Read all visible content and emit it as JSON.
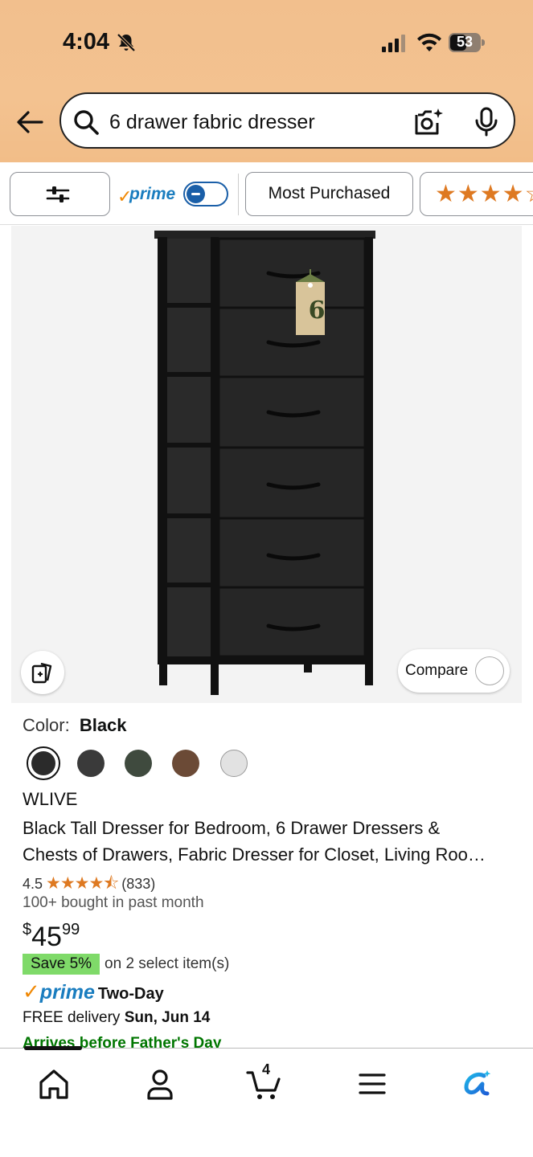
{
  "status_bar": {
    "time": "4:04",
    "battery": "53",
    "icons": [
      "bell-slash-icon",
      "cellular-signal-icon",
      "wifi-icon",
      "battery-icon"
    ]
  },
  "search": {
    "query": "6 drawer fabric dresser",
    "icons": [
      "back-arrow-icon",
      "search-icon",
      "camera-icon",
      "microphone-icon"
    ]
  },
  "filters": {
    "prime_label": "prime",
    "prime_toggle_on": false,
    "most_purchased": "Most Purchased",
    "stars_chip": "★★★★☆"
  },
  "product_image": {
    "tag_number": "6",
    "compare_label": "Compare"
  },
  "product": {
    "color_label": "Color:",
    "color_value": "Black",
    "swatches": [
      "#2b2b2b",
      "#3a3a3a",
      "#3f4a3e",
      "#6b4a36",
      "#e2e2e2"
    ],
    "brand": "WLIVE",
    "title_line1": "Black Tall Dresser for Bedroom, 6 Drawer Dressers &",
    "title_line2": "Chests of Drawers, Fabric Dresser for Closet, Living Roo…",
    "rating": "4.5",
    "stars": "★★★★⯪",
    "review_count": "(833)",
    "bought": "100+ bought in past month",
    "price_currency": "$",
    "price_whole": "45",
    "price_fraction": "99",
    "save_badge": "Save 5%",
    "save_text": "on 2 select item(s)",
    "prime_check": "✓",
    "prime_word": "prime",
    "prime_speed": "Two-Day",
    "delivery_prefix": "FREE delivery",
    "delivery_date": "Sun, Jun 14",
    "arrives": "Arrives before Father's Day"
  },
  "bottom_nav": {
    "cart_count": "4",
    "items": [
      "home-icon",
      "account-icon",
      "cart-icon",
      "menu-icon",
      "rufus-icon"
    ]
  },
  "colors": {
    "header_bg": "#f2bf8d",
    "link_blue": "#1a7dbf",
    "prime_orange": "#f08804",
    "star_orange": "#de7921",
    "save_green": "#7fda69",
    "arrives_green": "#007600"
  }
}
